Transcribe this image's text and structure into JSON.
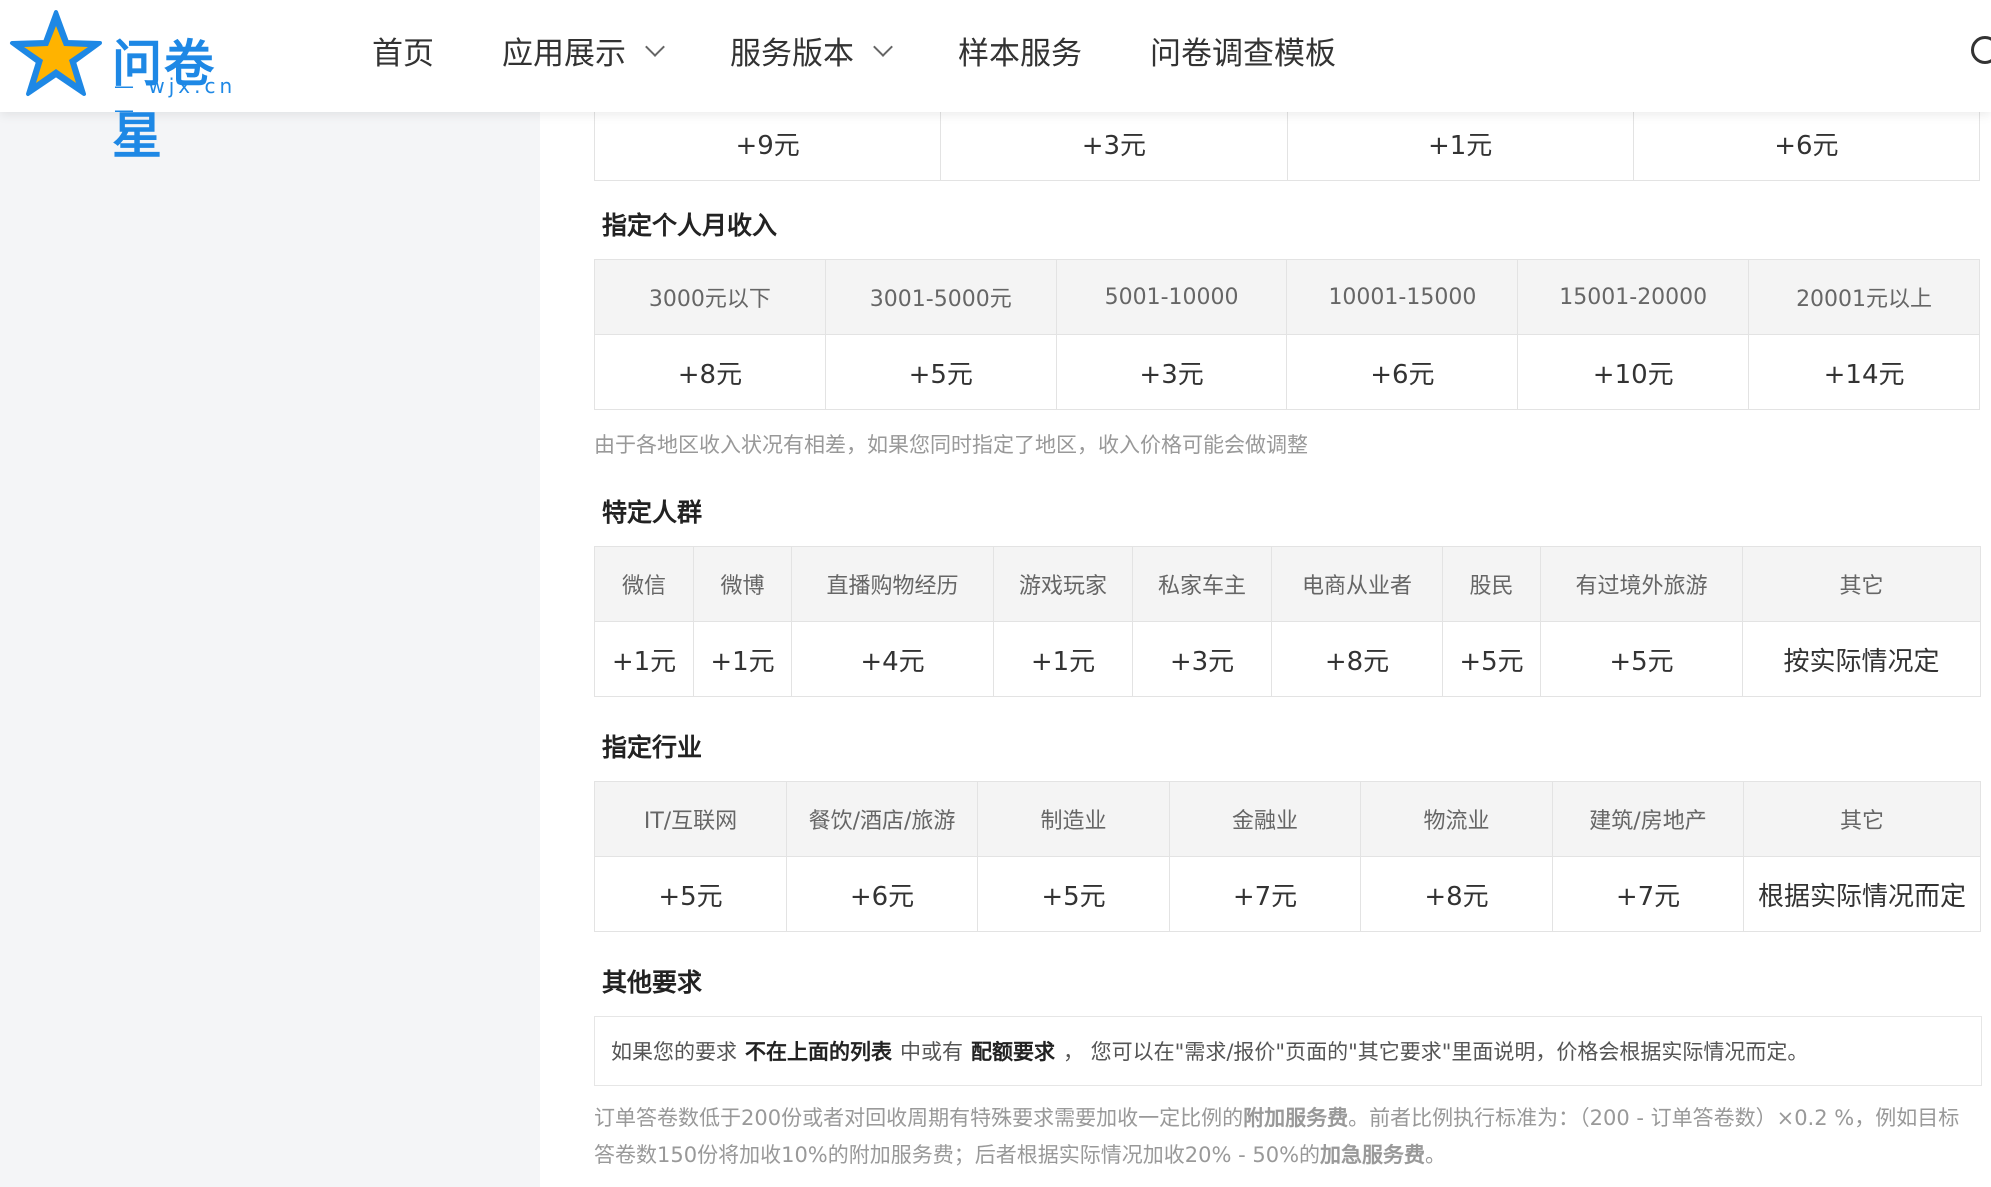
{
  "header": {
    "logo_text": "问卷星",
    "logo_sub": "— wjx.cn —",
    "nav": [
      {
        "label": "首页",
        "dropdown": false
      },
      {
        "label": "应用展示",
        "dropdown": true
      },
      {
        "label": "服务版本",
        "dropdown": true
      },
      {
        "label": "样本服务",
        "dropdown": false
      },
      {
        "label": "问卷调查模板",
        "dropdown": false
      }
    ]
  },
  "top_row": {
    "values": [
      "+9元",
      "+3元",
      "+1元",
      "+6元"
    ]
  },
  "income": {
    "title": "指定个人月收入",
    "headers": [
      "3000元以下",
      "3001-5000元",
      "5001-10000",
      "10001-15000",
      "15001-20000",
      "20001元以上"
    ],
    "values": [
      "+8元",
      "+5元",
      "+3元",
      "+6元",
      "+10元",
      "+14元"
    ],
    "note": "由于各地区收入状况有相差，如果您同时指定了地区，收入价格可能会做调整"
  },
  "groups": {
    "title": "特定人群",
    "headers": [
      "微信",
      "微博",
      "直播购物经历",
      "游戏玩家",
      "私家车主",
      "电商从业者",
      "股民",
      "有过境外旅游",
      "其它"
    ],
    "values": [
      "+1元",
      "+1元",
      "+4元",
      "+1元",
      "+3元",
      "+8元",
      "+5元",
      "+5元",
      "按实际情况定"
    ]
  },
  "industry": {
    "title": "指定行业",
    "headers": [
      "IT/互联网",
      "餐饮/酒店/旅游",
      "制造业",
      "金融业",
      "物流业",
      "建筑/房地产",
      "其它"
    ],
    "values": [
      "+5元",
      "+6元",
      "+5元",
      "+7元",
      "+8元",
      "+7元",
      "根据实际情况而定"
    ]
  },
  "other": {
    "title": "其他要求",
    "box_text_1": "如果您的要求",
    "box_bold_1": "不在上面的列表",
    "box_text_2": "中或有",
    "box_bold_2": "配额要求",
    "box_text_3": "，  您可以在\"需求/报价\"页面的\"其它要求\"里面说明，价格会根据实际情况而定。",
    "foot_1": "订单答卷数低于200份或者对回收周期有特殊要求需要加收一定比例的",
    "foot_bold_1": "附加服务费",
    "foot_2": "。前者比例执行标准为：（200 - 订单答卷数）×0.2 %，例如目标答卷数150份将加收10%的附加服务费；后者根据实际情况加收20% - 50%的",
    "foot_bold_2": "加急服务费",
    "foot_3": "。"
  }
}
